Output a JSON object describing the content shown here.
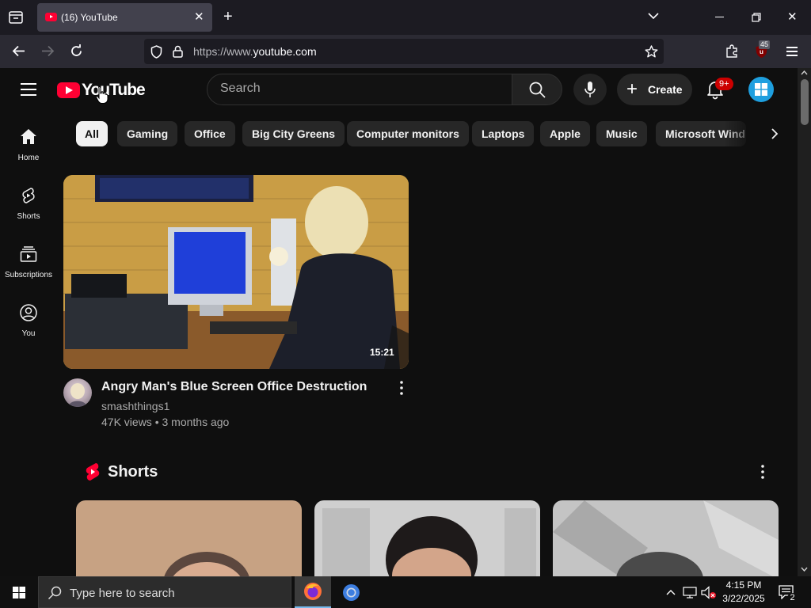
{
  "browser": {
    "tab_title": "(16) YouTube",
    "url_prefix": "https://www.",
    "url_domain": "youtube.com",
    "extension_badge": "45"
  },
  "youtube": {
    "logo_text": "YouTube",
    "search_placeholder": "Search",
    "create_label": "Create",
    "notification_badge": "9+",
    "sidebar": [
      {
        "label": "Home",
        "icon": "home-icon"
      },
      {
        "label": "Shorts",
        "icon": "shorts-icon"
      },
      {
        "label": "Subscriptions",
        "icon": "subscriptions-icon"
      },
      {
        "label": "You",
        "icon": "you-icon"
      }
    ],
    "chips": [
      "All",
      "Gaming",
      "Office",
      "Big City Greens",
      "Computer monitors",
      "Laptops",
      "Apple",
      "Music",
      "Microsoft Wind"
    ],
    "video": {
      "title": "Angry Man's Blue Screen Office Destruction",
      "channel": "smashthings1",
      "meta": "47K views • 3 months ago",
      "duration": "15:21"
    },
    "shorts_title": "Shorts"
  },
  "taskbar": {
    "search_text": "Type here to search",
    "time": "4:15 PM",
    "date": "3/22/2025",
    "notification_count": "2"
  },
  "colors": {
    "yt_red": "#ff0033",
    "bg": "#0f0f0f",
    "chip_bg": "#272727",
    "avatar": "#1e9fdf"
  }
}
